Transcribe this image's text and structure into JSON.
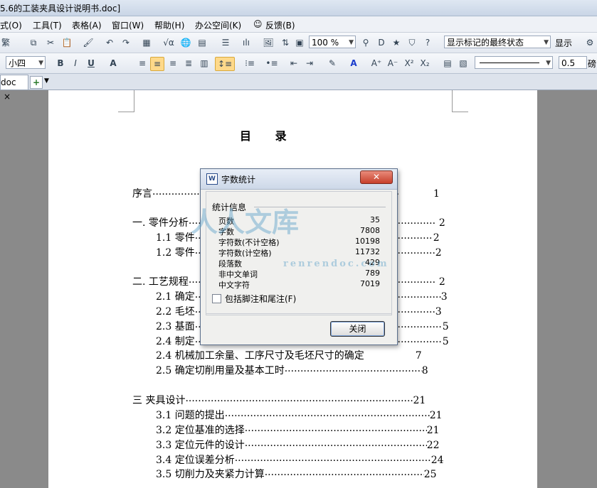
{
  "window": {
    "title": "5.6的工装夹具设计说明书.doc]"
  },
  "menu": [
    "式(O)",
    "工具(T)",
    "表格(A)",
    "窗口(W)",
    "帮助(H)",
    "办公空间(K)",
    "反馈(B)"
  ],
  "toolbar": {
    "trad_label": "繁",
    "zoom": "100 %",
    "markup_state": "显示标记的最终状态",
    "show_label": "显示"
  },
  "format": {
    "font_size": "小四",
    "line_width": "0.5",
    "extra": "磅"
  },
  "tab": {
    "label": "doc",
    "close": "×",
    "add": "+"
  },
  "document": {
    "title": "目  录",
    "toc": [
      {
        "text": "序言",
        "page": "1"
      },
      {
        "text": "一.  零件分析",
        "page": "2"
      },
      {
        "text": "1.1  零件",
        "page": "2"
      },
      {
        "text": "1.2 零件",
        "page": "2"
      },
      {
        "text": "二.  工艺规程",
        "page": "2"
      },
      {
        "text": "2.1 确定",
        "page": "3"
      },
      {
        "text": "2.2 毛坯",
        "page": "3"
      },
      {
        "text": "2.3 基面",
        "page": "5"
      },
      {
        "text": "2.4 制定",
        "page": "5"
      },
      {
        "text": "2.4 机械加工余量、工序尺寸及毛坯尺寸的确定",
        "page": "7"
      },
      {
        "text": "2.5 确定切削用量及基本工时",
        "page": "8"
      },
      {
        "text": "三  夹具设计",
        "page": "21"
      },
      {
        "text": "3.1 问题的提出",
        "page": "21"
      },
      {
        "text": "3.2 定位基准的选择",
        "page": "21"
      },
      {
        "text": "3.3 定位元件的设计",
        "page": "22"
      },
      {
        "text": "3.4 定位误差分析",
        "page": "24"
      },
      {
        "text": "3.5 切削力及夹紧力计算",
        "page": "25"
      }
    ]
  },
  "dialog": {
    "title": "字数统计",
    "close_symbol": "✕",
    "section": "统计信息",
    "stats": [
      {
        "label": "页数",
        "value": "35"
      },
      {
        "label": "字数",
        "value": "7808"
      },
      {
        "label": "字符数(不计空格)",
        "value": "10198"
      },
      {
        "label": "字符数(计空格)",
        "value": "11732"
      },
      {
        "label": "段落数",
        "value": "429"
      },
      {
        "label": "非中文单词",
        "value": "789"
      },
      {
        "label": "中文字符",
        "value": "7019"
      }
    ],
    "checkbox_label": "包括脚注和尾注(F)",
    "close_button": "关闭"
  },
  "watermark": {
    "text": "人人文库",
    "url": "renrendoc.com"
  }
}
